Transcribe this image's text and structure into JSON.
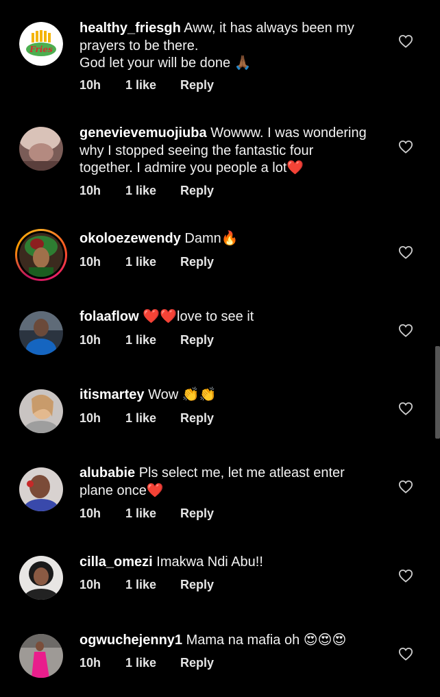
{
  "comments": [
    {
      "username": "healthy_friesgh",
      "lines": [
        "Aww, it has always been my",
        "prayers to be there.",
        "God let your will be done 🙏🏾"
      ],
      "time": "10h",
      "likes": "1 like",
      "reply": "Reply",
      "logo_text": "Fries"
    },
    {
      "username": "genevievemuojiuba",
      "lines": [
        "Wowww. I was wondering",
        "why I stopped seeing the fantastic four",
        "together. I admire you people a lot❤️"
      ],
      "time": "10h",
      "likes": "1 like",
      "reply": "Reply"
    },
    {
      "username": "okoloezewendy",
      "lines": [
        "Damn🔥"
      ],
      "time": "10h",
      "likes": "1 like",
      "reply": "Reply"
    },
    {
      "username": "folaaflow",
      "lines": [
        "❤️❤️love to see it"
      ],
      "time": "10h",
      "likes": "1 like",
      "reply": "Reply"
    },
    {
      "username": "itismartey",
      "lines": [
        "Wow 👏👏"
      ],
      "time": "10h",
      "likes": "1 like",
      "reply": "Reply"
    },
    {
      "username": "alubabie",
      "lines": [
        "Pls select me, let me atleast enter",
        "plane once❤️"
      ],
      "time": "10h",
      "likes": "1 like",
      "reply": "Reply"
    },
    {
      "username": "cilla_omezi",
      "lines": [
        "Imakwa Ndi Abu!!"
      ],
      "time": "10h",
      "likes": "1 like",
      "reply": "Reply"
    },
    {
      "username": "ogwuchejenny1",
      "lines": [
        "Mama na mafia oh 😍😍😍"
      ],
      "time": "10h",
      "likes": "1 like",
      "reply": "Reply"
    }
  ],
  "icons": {
    "like": "heart-outline-icon"
  },
  "colors": {
    "background": "#000000",
    "text": "#f2f2f2",
    "story_ring": "#e91e63"
  }
}
